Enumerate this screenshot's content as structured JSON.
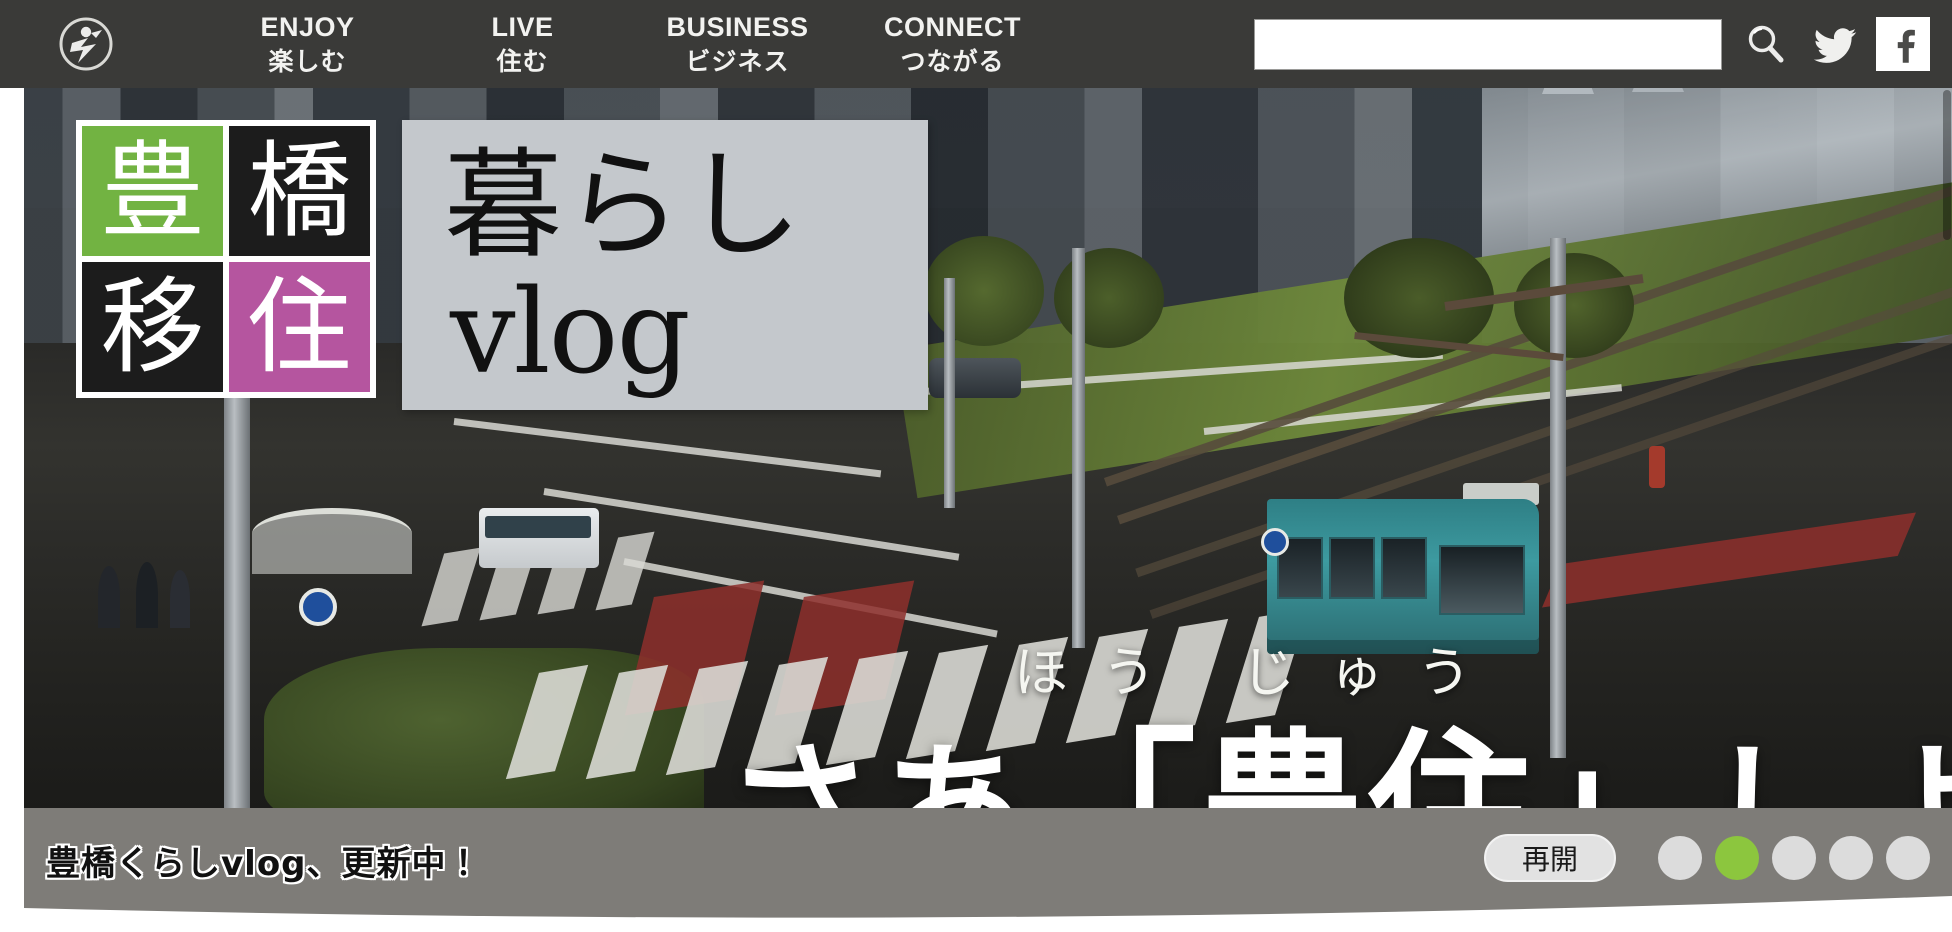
{
  "site": {
    "logo_icon": "toyohashi-emblem-icon",
    "accent_green": "#72b342",
    "accent_magenta": "#b5559f",
    "nav_bg": "#3a3a38",
    "caption_bg": "#7e7c78"
  },
  "nav": {
    "items": [
      {
        "en": "ENJOY",
        "ja": "楽しむ"
      },
      {
        "en": "LIVE",
        "ja": "住む"
      },
      {
        "en": "BUSINESS",
        "ja": "ビジネス"
      },
      {
        "en": "CONNECT",
        "ja": "つながる"
      }
    ],
    "search": {
      "value": "",
      "placeholder": ""
    },
    "icons": {
      "search": "search-icon",
      "twitter": "twitter-icon",
      "facebook": "facebook-icon"
    }
  },
  "hero": {
    "badge": {
      "cells": [
        "豊",
        "橋",
        "移",
        "住"
      ],
      "colors": [
        "#72b342",
        "#1c1c1c",
        "#1c1c1c",
        "#b5559f"
      ]
    },
    "vlog_panel": {
      "line1": "暮らし",
      "line2": "vlog",
      "bg": "#c4c8cc"
    },
    "overlay": {
      "furigana": "ほう じゅう",
      "headline_prefix": "さあ",
      "headline": "「豊住」",
      "headline_suffix": "しよう"
    }
  },
  "caption": {
    "text": "豊橋くらしvlog、更新中！",
    "resume_label": "再開",
    "dots_total": 5,
    "dots_active_index": 1
  }
}
